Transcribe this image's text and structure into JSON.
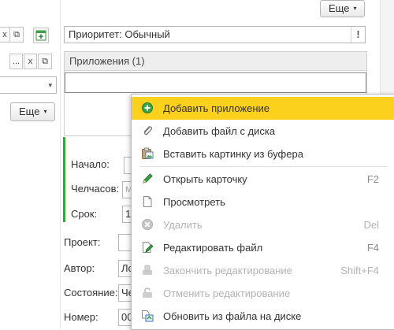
{
  "colors": {
    "selection": "#fbd11e",
    "green_accent": "#3aa346",
    "border": "#b8b8b8"
  },
  "toolbar_top": {
    "more_label": "Еще"
  },
  "left_panel": {
    "more_label": "Еще",
    "row1_buttons": [
      "x",
      "⧉"
    ],
    "row2_buttons": [
      "...",
      "x",
      "⧉"
    ],
    "dropdown_arrow": "▾",
    "more_caret": "▾",
    "top_caret": "▾"
  },
  "priority": {
    "value": "Приоритет: Обычный",
    "mark": "!"
  },
  "attachments": {
    "header": "Приложения (1)"
  },
  "form": {
    "start_label": "Начало:",
    "manhours_label": "Челчасов:",
    "manhours_hint": "М",
    "due_label": "Срок:",
    "due_value": "1",
    "project_label": "Проект:",
    "author_label": "Автор:",
    "author_value": "Ло",
    "status_label": "Состояние:",
    "status_value": "Че",
    "number_label": "Номер:",
    "number_value": "00"
  },
  "context_menu": {
    "items": [
      {
        "label": "Добавить приложение",
        "shortcut": "",
        "icon": "add-green-circle-icon",
        "disabled": false,
        "selected": true
      },
      {
        "label": "Добавить файл с диска",
        "shortcut": "",
        "icon": "paperclip-icon",
        "disabled": false,
        "selected": false
      },
      {
        "label": "Вставить картинку из буфера",
        "shortcut": "",
        "icon": "paste-picture-icon",
        "disabled": false,
        "selected": false
      },
      {
        "label": "Открыть карточку",
        "shortcut": "F2",
        "icon": "pencil-icon",
        "disabled": false,
        "selected": false
      },
      {
        "label": "Просмотреть",
        "shortcut": "",
        "icon": "document-icon",
        "disabled": false,
        "selected": false
      },
      {
        "label": "Удалить",
        "shortcut": "Del",
        "icon": "delete-circle-icon",
        "disabled": true,
        "selected": false
      },
      {
        "label": "Редактировать файл",
        "shortcut": "F4",
        "icon": "edit-file-icon",
        "disabled": false,
        "selected": false
      },
      {
        "label": "Закончить редактирование",
        "shortcut": "Shift+F4",
        "icon": "finish-edit-icon",
        "disabled": true,
        "selected": false
      },
      {
        "label": "Отменить редактирование",
        "shortcut": "",
        "icon": "cancel-edit-icon",
        "disabled": true,
        "selected": false
      },
      {
        "label": "Обновить из файла на диске",
        "shortcut": "",
        "icon": "update-from-disk-icon",
        "disabled": false,
        "selected": false
      }
    ]
  }
}
